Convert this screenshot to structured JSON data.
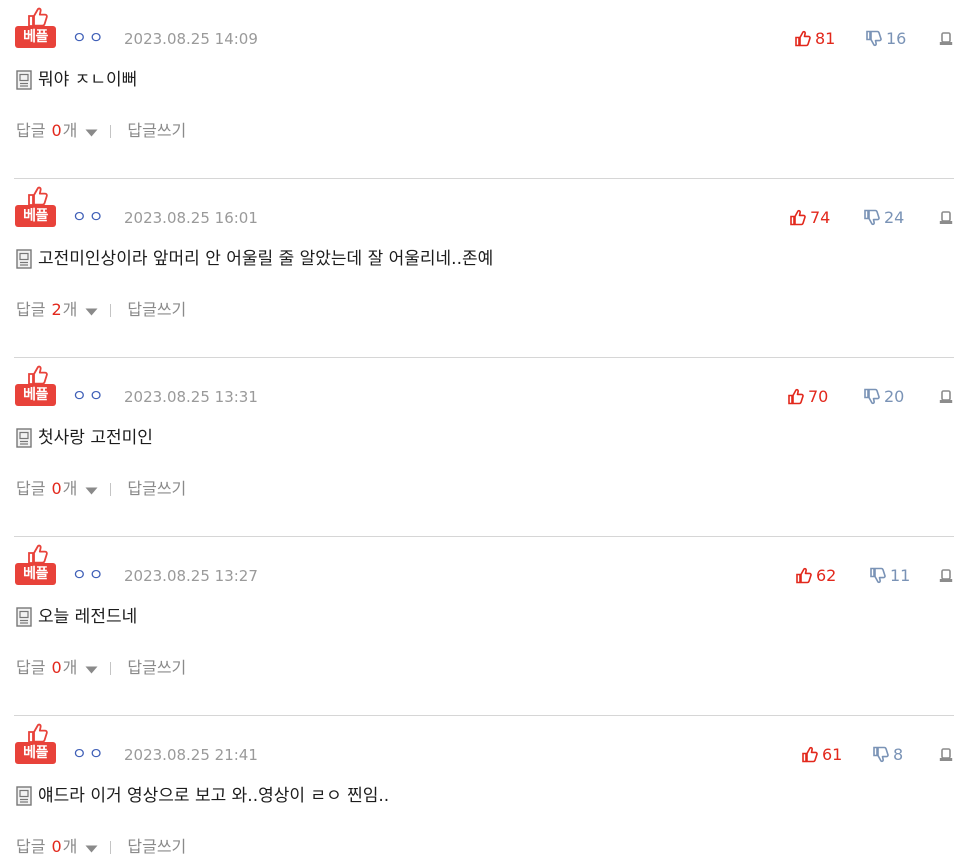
{
  "comments": [
    {
      "badge": "베플",
      "nickname": "ㅇㅇ",
      "date": "2023.08.25 14:09",
      "up": "81",
      "down": "16",
      "text": "뭐야 ㅈㄴ이뻐",
      "reply_label": "답글",
      "reply_count": "0",
      "reply_unit": "개",
      "write_label": "답글쓰기"
    },
    {
      "badge": "베플",
      "nickname": "ㅇㅇ",
      "date": "2023.08.25 16:01",
      "up": "74",
      "down": "24",
      "text": "고전미인상이라 앞머리 안 어울릴 줄 알았는데 잘 어울리네..존예",
      "reply_label": "답글",
      "reply_count": "2",
      "reply_unit": "개",
      "write_label": "답글쓰기"
    },
    {
      "badge": "베플",
      "nickname": "ㅇㅇ",
      "date": "2023.08.25 13:31",
      "up": "70",
      "down": "20",
      "text": "첫사랑 고전미인",
      "reply_label": "답글",
      "reply_count": "0",
      "reply_unit": "개",
      "write_label": "답글쓰기"
    },
    {
      "badge": "베플",
      "nickname": "ㅇㅇ",
      "date": "2023.08.25 13:27",
      "up": "62",
      "down": "11",
      "text": "오늘 레전드네",
      "reply_label": "답글",
      "reply_count": "0",
      "reply_unit": "개",
      "write_label": "답글쓰기"
    },
    {
      "badge": "베플",
      "nickname": "ㅇㅇ",
      "date": "2023.08.25 21:41",
      "up": "61",
      "down": "8",
      "text": "얘드라 이거 영상으로 보고 와..영상이 ㄹㅇ 찐임..",
      "reply_label": "답글",
      "reply_count": "0",
      "reply_unit": "개",
      "write_label": "답글쓰기"
    }
  ],
  "colors": {
    "badge": "#e8423a",
    "up": "#e2281c",
    "down": "#7a93b6",
    "nickname": "#3f5fb7",
    "meta": "#9a9a9a"
  }
}
